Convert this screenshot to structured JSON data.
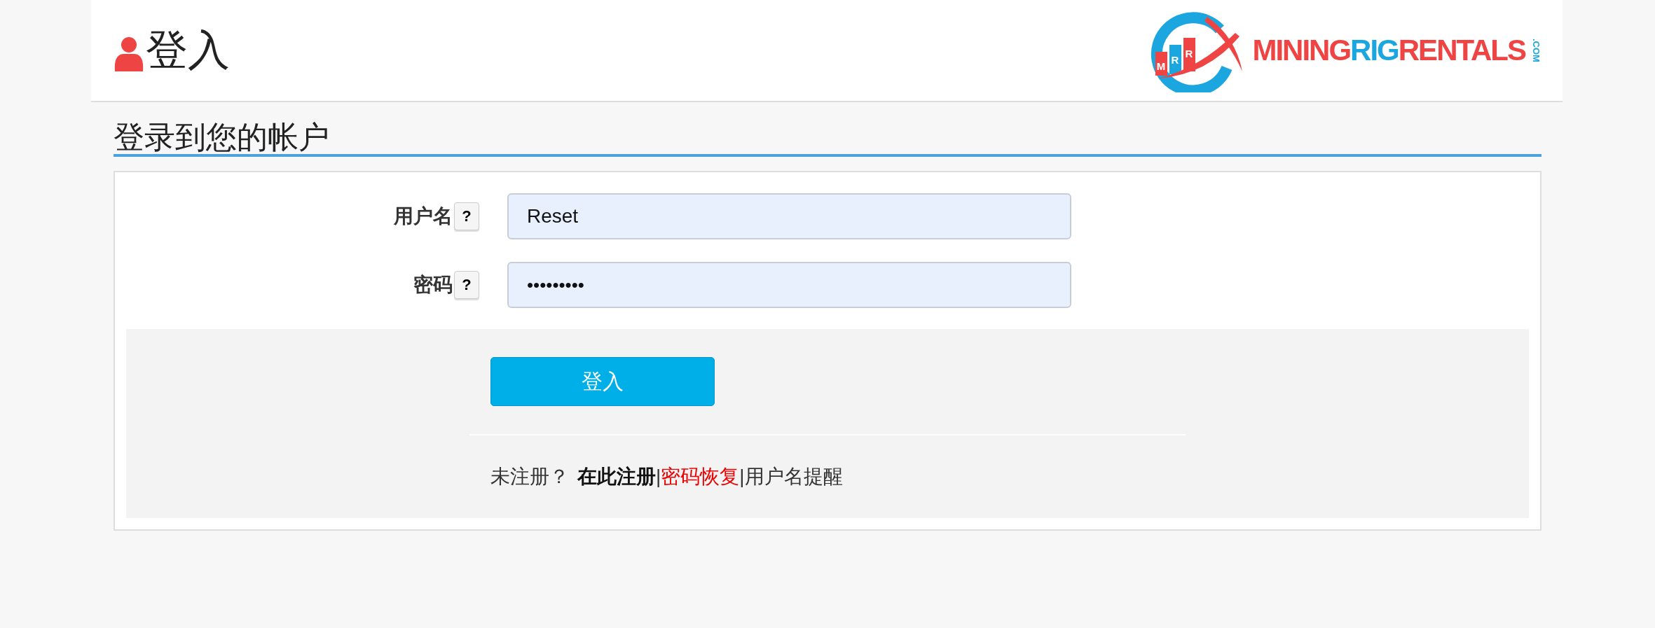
{
  "header": {
    "title": "登入",
    "logo": {
      "badge": [
        "M",
        "R",
        "R"
      ],
      "words": [
        {
          "text": "MINING",
          "color": "#ef4444"
        },
        {
          "text": "RIG",
          "color": "#1ba6e0"
        },
        {
          "text": "RENTALS",
          "color": "#ef4444"
        }
      ],
      "suffix": ".COM"
    }
  },
  "section_title": "登录到您的帐户",
  "fields": [
    {
      "label": "用户名",
      "help": "?",
      "kind": "text",
      "value": "Reset"
    },
    {
      "label": "密码",
      "help": "?",
      "kind": "password",
      "value": "•••••••••"
    }
  ],
  "submit": "登入",
  "footer": [
    {
      "text": "未注册？",
      "kind": "plain"
    },
    {
      "text": "在此注册",
      "kind": "bold-link"
    },
    {
      "text": "|",
      "kind": "separator"
    },
    {
      "text": "密码恢复",
      "kind": "red-link"
    },
    {
      "text": "|",
      "kind": "separator"
    },
    {
      "text": "用户名提醒",
      "kind": "link"
    }
  ]
}
